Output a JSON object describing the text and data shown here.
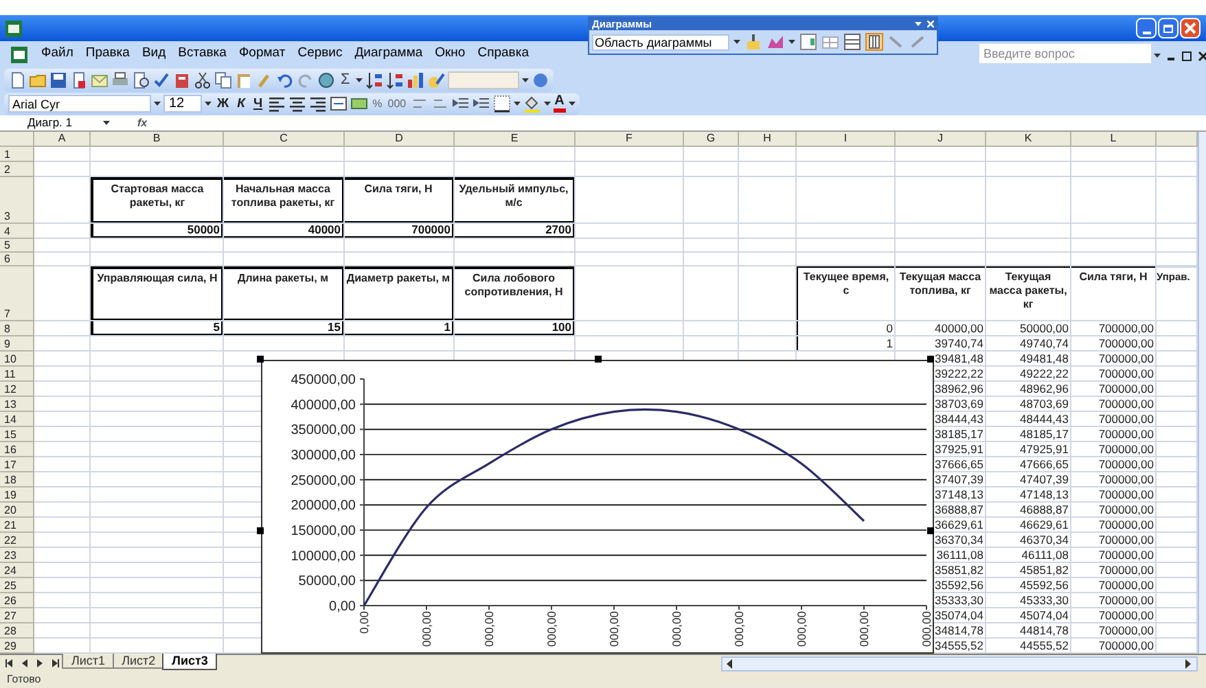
{
  "chart_toolbar": {
    "title": "Диаграммы",
    "element_select": "Область диаграммы"
  },
  "menu": [
    "Файл",
    "Правка",
    "Вид",
    "Вставка",
    "Формат",
    "Сервис",
    "Диаграмма",
    "Окно",
    "Справка"
  ],
  "help_search": {
    "placeholder": "Введите вопрос"
  },
  "standard_toolbar": {
    "sum_symbol": "Σ"
  },
  "formatting_toolbar": {
    "font": "Arial Cyr",
    "size": "12",
    "styles": [
      "Ж",
      "К",
      "Ч"
    ],
    "number_formats": [
      "%",
      "000"
    ],
    "font_color_label": "A"
  },
  "name_box": "Диагр. 1",
  "fx_label": "fx",
  "columns": [
    "A",
    "B",
    "C",
    "D",
    "E",
    "F",
    "G",
    "H",
    "I",
    "J",
    "K",
    "L"
  ],
  "rows": [
    "1",
    "2",
    "3",
    "4",
    "5",
    "6",
    "7",
    "8",
    "9",
    "10",
    "11",
    "12",
    "13",
    "14",
    "15",
    "16",
    "17",
    "18",
    "19",
    "20",
    "21",
    "22",
    "23",
    "24",
    "25",
    "26",
    "27",
    "28",
    "29"
  ],
  "parameter_tables": [
    {
      "headers": [
        "Стартовая масса ракеты, кг",
        "Начальная масса топлива ракеты, кг",
        "Сила тяги, Н",
        "Удельный импульс, м/с"
      ],
      "values": [
        "50000",
        "40000",
        "700000",
        "2700"
      ]
    },
    {
      "headers": [
        "Управляющая сила, Н",
        "Длина ракеты, м",
        "Диаметр ракеты, м",
        "Сила лобового сопротивления, Н"
      ],
      "values": [
        "5",
        "15",
        "1",
        "100"
      ]
    }
  ],
  "results_table": {
    "columns": [
      "Текущее время, с",
      "Текущая масса топлива, кг",
      "Текущая масса ракеты, кг",
      "Сила тяги, Н",
      "Управ."
    ],
    "rows": [
      {
        "time": "0",
        "fuel": "40000,00",
        "mass": "50000,00",
        "thrust": "700000,00"
      },
      {
        "time": "1",
        "fuel": "39740,74",
        "mass": "49740,74",
        "thrust": "700000,00"
      },
      {
        "fuel": "39481,48",
        "mass": "49481,48",
        "thrust": "700000,00"
      },
      {
        "fuel": "39222,22",
        "mass": "49222,22",
        "thrust": "700000,00"
      },
      {
        "fuel": "38962,96",
        "mass": "48962,96",
        "thrust": "700000,00"
      },
      {
        "fuel": "38703,69",
        "mass": "48703,69",
        "thrust": "700000,00"
      },
      {
        "fuel": "38444,43",
        "mass": "48444,43",
        "thrust": "700000,00"
      },
      {
        "fuel": "38185,17",
        "mass": "48185,17",
        "thrust": "700000,00"
      },
      {
        "fuel": "37925,91",
        "mass": "47925,91",
        "thrust": "700000,00"
      },
      {
        "fuel": "37666,65",
        "mass": "47666,65",
        "thrust": "700000,00"
      },
      {
        "fuel": "37407,39",
        "mass": "47407,39",
        "thrust": "700000,00"
      },
      {
        "fuel": "37148,13",
        "mass": "47148,13",
        "thrust": "700000,00"
      },
      {
        "fuel": "36888,87",
        "mass": "46888,87",
        "thrust": "700000,00"
      },
      {
        "fuel": "36629,61",
        "mass": "46629,61",
        "thrust": "700000,00"
      },
      {
        "fuel": "36370,34",
        "mass": "46370,34",
        "thrust": "700000,00"
      },
      {
        "fuel": "36111,08",
        "mass": "46111,08",
        "thrust": "700000,00"
      },
      {
        "fuel": "35851,82",
        "mass": "45851,82",
        "thrust": "700000,00"
      },
      {
        "fuel": "35592,56",
        "mass": "45592,56",
        "thrust": "700000,00"
      },
      {
        "fuel": "35333,30",
        "mass": "45333,30",
        "thrust": "700000,00"
      },
      {
        "fuel": "35074,04",
        "mass": "45074,04",
        "thrust": "700000,00"
      },
      {
        "fuel": "34814,78",
        "mass": "44814,78",
        "thrust": "700000,00"
      },
      {
        "fuel": "34555,52",
        "mass": "44555,52",
        "thrust": "700000,00"
      }
    ]
  },
  "chart_data": {
    "type": "line",
    "categories": [
      "0,00",
      "000,00",
      "000,00",
      "000,00",
      "000,00",
      "000,00",
      "000,00",
      "000,00",
      "000,00",
      "000,00"
    ],
    "series": [
      {
        "color": "#2a2a6a",
        "values": [
          0,
          195000,
          282000,
          350000,
          385000,
          385000,
          350000,
          282000,
          168000,
          null
        ]
      }
    ],
    "ylim": [
      0,
      450000
    ],
    "grid": true,
    "yticks": [
      {
        "value": 0,
        "label": "0,00"
      },
      {
        "value": 50000,
        "label": "50000,00"
      },
      {
        "value": 100000,
        "label": "100000,00"
      },
      {
        "value": 150000,
        "label": "150000,00"
      },
      {
        "value": 200000,
        "label": "200000,00"
      },
      {
        "value": 250000,
        "label": "250000,00"
      },
      {
        "value": 300000,
        "label": "300000,00"
      },
      {
        "value": 350000,
        "label": "350000,00"
      },
      {
        "value": 400000,
        "label": "400000,00"
      },
      {
        "value": 450000,
        "label": "450000,00"
      }
    ]
  },
  "sheet_tabs": [
    {
      "label": "Лист1",
      "selected": false
    },
    {
      "label": "Лист2",
      "selected": false
    },
    {
      "label": "Лист3",
      "selected": true
    }
  ],
  "status": "Готово"
}
